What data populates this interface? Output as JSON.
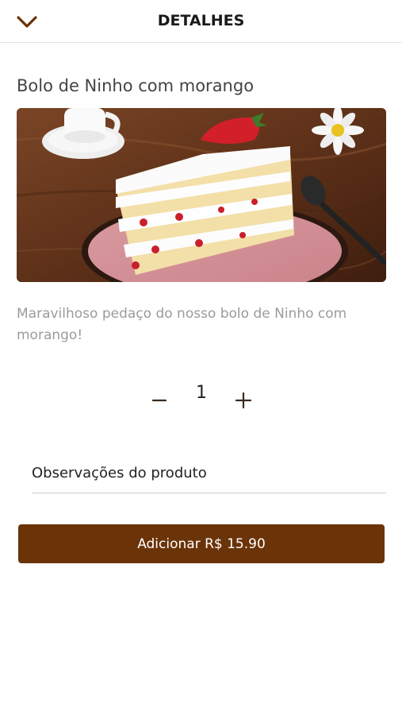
{
  "header": {
    "title": "DETALHES",
    "back_icon": "chevron-down-icon"
  },
  "colors": {
    "brand": "#6b3308",
    "description_text": "#9b9b9b"
  },
  "product": {
    "name": "Bolo de Ninho com morango",
    "image_subject": "cake-slice-photo",
    "description": "Maravilhoso pedaço do nosso bolo de Ninho com morango!"
  },
  "quantity": {
    "value": "1",
    "minus_icon": "minus-icon",
    "plus_icon": "plus-icon"
  },
  "notes": {
    "placeholder": "Observações do produto"
  },
  "action": {
    "add_label": "Adicionar R$ 15.90"
  }
}
